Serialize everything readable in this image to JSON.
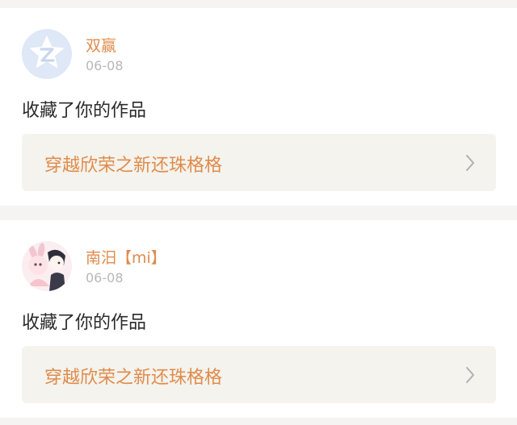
{
  "items": [
    {
      "username": "双赢",
      "date": "06-08",
      "action": "收藏了你的作品",
      "work_title": "穿越欣荣之新还珠格格",
      "avatar_icon": "qq-default-avatar-icon"
    },
    {
      "username": "南汨【mi】",
      "date": "06-08",
      "action": "收藏了你的作品",
      "work_title": "穿越欣荣之新还珠格格",
      "avatar_icon": "anime-character-avatar"
    }
  ],
  "colors": {
    "accent": "#e08b4b",
    "date": "#b8b8b8",
    "link_bg": "#f4f3ed",
    "page_bg": "#f5f4f2"
  }
}
